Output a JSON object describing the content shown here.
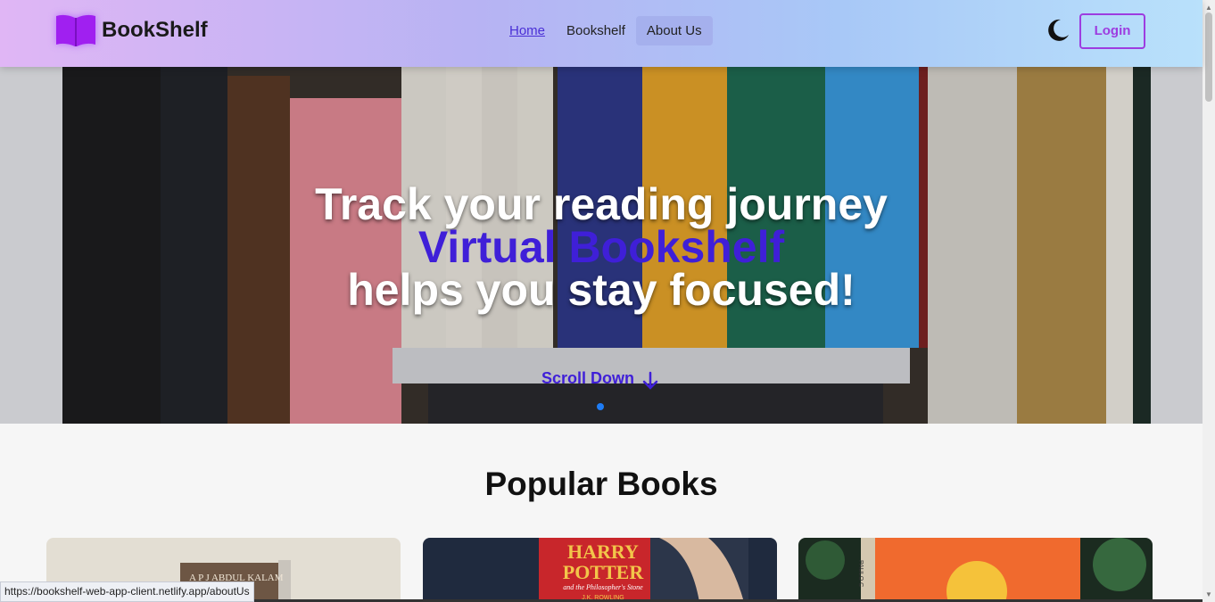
{
  "navbar": {
    "brand": "BookShelf",
    "links": [
      {
        "label": "Home"
      },
      {
        "label": "Bookshelf"
      },
      {
        "label": "About Us"
      }
    ],
    "login_label": "Login",
    "theme_icon": "moon-icon"
  },
  "hero": {
    "line1": "Track your reading journey",
    "line2": "Virtual Bookshelf",
    "line3": "helps you stay focused!",
    "scroll_label": "Scroll Down",
    "scroll_icon": "arrow-down-icon"
  },
  "popular": {
    "title": "Popular Books",
    "cards": [
      {
        "cover_text": "A P J ABDUL KALAM"
      },
      {
        "cover_title": "HARRY POTTER",
        "cover_subtitle": "and the Philosopher's Stone",
        "cover_author": "J.K. ROWLING"
      },
      {
        "cover_text": "PAULO C"
      }
    ]
  },
  "status_bar": {
    "url": "https://bookshelf-web-app-client.netlify.app/aboutUs"
  },
  "colors": {
    "accent": "#3f1fd8",
    "brand_purple": "#9d3ce0",
    "nav_active": "#a5b0ed"
  }
}
